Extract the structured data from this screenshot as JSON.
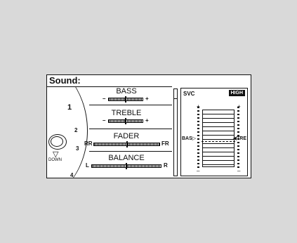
{
  "title": "Sound:",
  "knob": {
    "arrow": "▽",
    "label": "DOWN"
  },
  "positions": [
    "1",
    "2",
    "3",
    "4"
  ],
  "controls": [
    {
      "label": "BASS",
      "left": "–",
      "right": "+",
      "value": 0.5
    },
    {
      "label": "TREBLE",
      "left": "–",
      "right": "+",
      "value": 0.5
    },
    {
      "label": "FADER",
      "left": "RR",
      "right": "FR",
      "value": 0.5
    },
    {
      "label": "BALANCE",
      "left": "L",
      "right": "R",
      "value": 0.5
    }
  ],
  "svc": {
    "label": "SVC",
    "badge": "HIGH",
    "plus_left": "+",
    "plus_right": "+",
    "minus_left": "–",
    "minus_right": "–",
    "bas_label": "BAS",
    "tre_label": "TRE",
    "bas_marker": "▷",
    "tre_marker": "◀"
  }
}
